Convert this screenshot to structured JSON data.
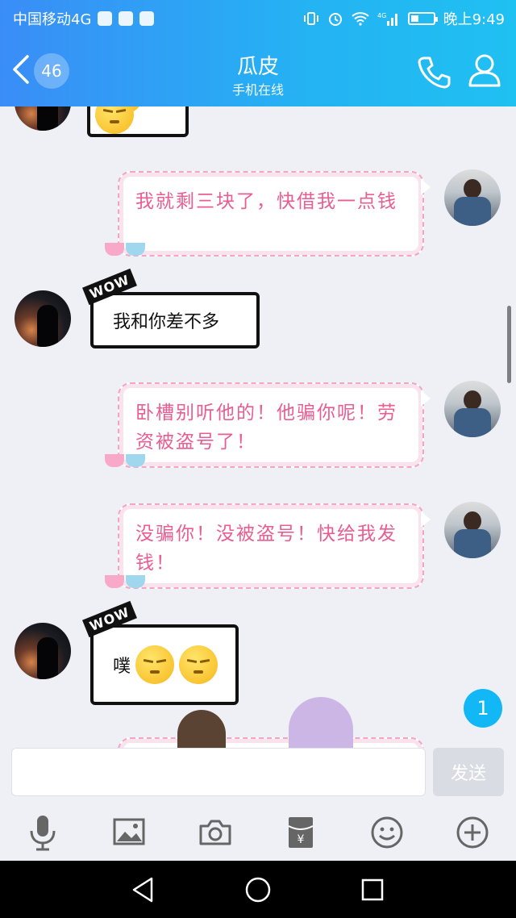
{
  "status_bar": {
    "carrier": "中国移动4G",
    "time": "晚上9:49",
    "battery_level": 0.35
  },
  "header": {
    "back_icon": "chevron-left-icon",
    "unread_count": "46",
    "contact_name": "瓜皮",
    "status": "手机在线",
    "call_icon": "phone-icon",
    "profile_icon": "person-icon"
  },
  "messages": [
    {
      "side": "left",
      "style": "comic",
      "content": "partial-emoji"
    },
    {
      "side": "right",
      "style": "pink",
      "text": "我就剩三块了，快借我一点钱"
    },
    {
      "side": "left",
      "style": "comic",
      "text": "我和你差不多",
      "tag": "WOW"
    },
    {
      "side": "right",
      "style": "pink",
      "text": "卧槽别听他的！他骗你呢！劳资被盗号了！"
    },
    {
      "side": "right",
      "style": "pink",
      "text": "没骗你！没被盗号！快给我发钱！"
    },
    {
      "side": "left",
      "style": "comic",
      "text": "噗",
      "tag": "WOW"
    }
  ],
  "new_message_count": "1",
  "composer": {
    "input_value": "",
    "send_label": "发送"
  },
  "toolbar": {
    "icons": [
      "microphone-icon",
      "image-icon",
      "camera-icon",
      "red-packet-icon",
      "emoji-icon",
      "plus-icon"
    ]
  },
  "colors": {
    "header_start": "#3a8df7",
    "header_end": "#1fc0f2",
    "pink_text": "#e85d92",
    "unread_badge": "#12b7f5"
  }
}
